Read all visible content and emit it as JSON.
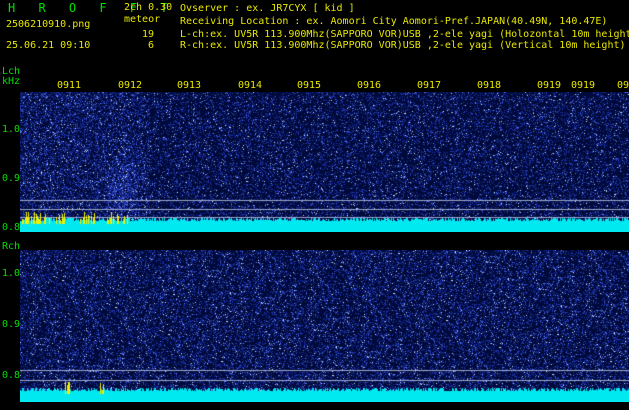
{
  "header": {
    "app_name": "H R O F F T",
    "version": "2ch 0.30",
    "filename": "2506210910.png",
    "meteor_label": "meteor",
    "count_l": "19",
    "count_r": "6",
    "datetime": "25.06.21 09:10",
    "observer": "Ovserver              : ex. JR7CYX [ kid ]",
    "location": "Receiving Location : ex. Aomori City Aomori-Pref.JAPAN(40.49N, 140.47E)",
    "lch_info": "L-ch:ex. UV5R 113.900Mhz(SAPPORO VOR)USB ,2-ele yagi (Holozontal 10m height)",
    "rch_info": "R-ch:ex. UV5R 113.900Mhz(SAPPORO VOR)USB ,2-ele yagi (Vertical 10m height)"
  },
  "lch": {
    "label": "Lch",
    "unit": "kHz",
    "yticks": [
      {
        "label": "1.0",
        "value": 1.0
      },
      {
        "label": "0.9",
        "value": 0.9
      },
      {
        "label": "0.8",
        "value": 0.8
      }
    ]
  },
  "rch": {
    "label": "Rch",
    "yticks": [
      {
        "label": "1.0",
        "value": 1.0
      },
      {
        "label": "0.9",
        "value": 0.9
      },
      {
        "label": "0.8",
        "value": 0.8
      }
    ]
  },
  "time_axis": {
    "labels": [
      "0911",
      "0912",
      "0913",
      "0914",
      "0915",
      "0916",
      "0917",
      "0918",
      "0919",
      "0919",
      "09"
    ]
  },
  "colors": {
    "background": "#000000",
    "label_yellow": "#e8e800",
    "label_green": "#00e000",
    "waterfall_base": "#000a3a",
    "signal_cyan": "#00e8f0",
    "meteor_yellow": "#f0f000",
    "ref_line": "#9aa6c8"
  }
}
